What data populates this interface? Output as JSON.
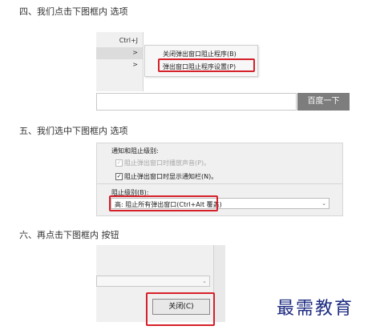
{
  "steps": {
    "s4": "四、我们点击下图框内 选项",
    "s5": "五、我们选中下图框内 选项",
    "s6": "六、再点击下图框内 按钮"
  },
  "section1": {
    "shortcut": "Ctrl+J",
    "submenu_arrows": [
      ">",
      ">"
    ],
    "menu_items": [
      "关闭弹出窗口阻止程序(B)",
      "弹出窗口阻止程序设置(P)"
    ],
    "search_button": "百度一下"
  },
  "section2": {
    "group_label": "通知和阻止级别:",
    "option_sound": "阻止弹出窗口时播放声音(P)。",
    "option_bar": "阻止弹出窗口时显示通知栏(N)。",
    "level_label": "阻止级别(B):",
    "level_value": "高: 阻止所有弹出窗口(Ctrl+Alt 覆盖)"
  },
  "section3": {
    "close_button": "关闭(C)"
  },
  "watermark": "最需教育",
  "colors": {
    "highlight": "#d6202a",
    "watermark": "#1d2b80"
  }
}
